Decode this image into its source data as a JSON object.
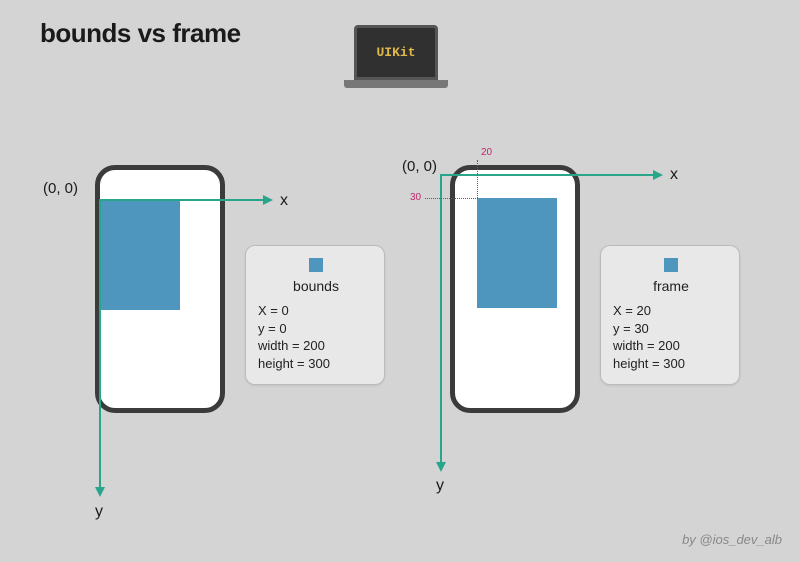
{
  "title": "bounds vs frame",
  "laptop_brand": "UIKit",
  "byline": "by @ios_dev_alb",
  "origin_label": "(0, 0)",
  "axis": {
    "x": "x",
    "y": "y"
  },
  "offsets": {
    "x": "20",
    "y": "30"
  },
  "cards": {
    "bounds": {
      "label": "bounds",
      "x": "X = 0",
      "y": "y = 0",
      "width": "width = 200",
      "height": "height = 300"
    },
    "frame": {
      "label": "frame",
      "x": "X = 20",
      "y": "y = 30",
      "width": "width = 200",
      "height": "height = 300"
    }
  }
}
